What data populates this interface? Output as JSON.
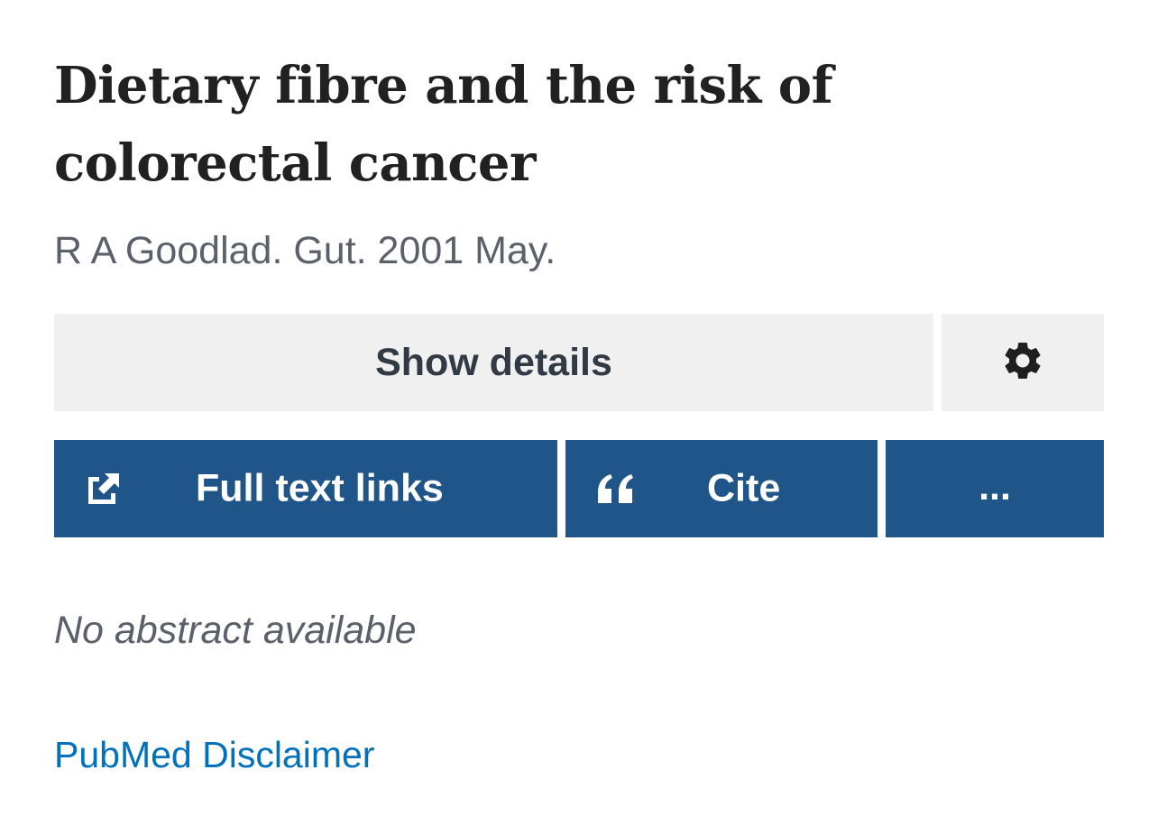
{
  "article": {
    "title": "Dietary fibre and the risk of colorectal cancer",
    "citation": "R A Goodlad. Gut. 2001 May."
  },
  "actions": {
    "show_details_label": "Show details",
    "settings_icon": "gear-icon",
    "full_text_label": "Full text links",
    "full_text_icon": "external-link-icon",
    "cite_label": "Cite",
    "cite_icon": "quote-icon",
    "more_label": "..."
  },
  "abstract": {
    "text": "No abstract available"
  },
  "footer": {
    "disclaimer_label": "PubMed Disclaimer"
  },
  "colors": {
    "primary_button": "#20558a",
    "secondary_button": "#f0f0f0",
    "link": "#0071bc",
    "muted_text": "#5b616b",
    "title_text": "#212121"
  }
}
